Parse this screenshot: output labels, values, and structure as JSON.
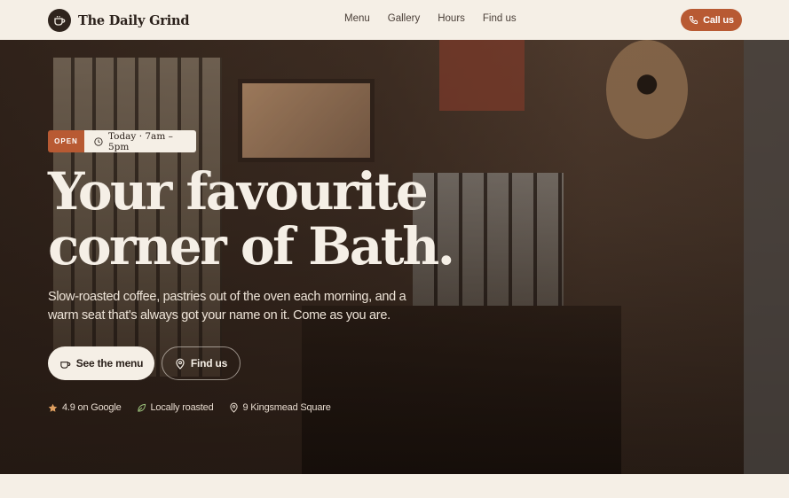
{
  "header": {
    "brand_name": "The Daily Grind",
    "nav": [
      "Menu",
      "Gallery",
      "Hours",
      "Find us"
    ],
    "call_label": "Call us"
  },
  "hero": {
    "status_badge": "OPEN",
    "hours": "Today · 7am – 5pm",
    "headline_line1": "Your favourite",
    "headline_line2": "corner of Bath.",
    "subtitle": "Slow-roasted coffee, pastries out of the oven each morning, and a warm seat that's always got your name on it. Come as you are.",
    "primary_cta": "See the menu",
    "secondary_cta": "Find us",
    "stats": [
      {
        "icon": "star-icon",
        "label": "4.9 on Google"
      },
      {
        "icon": "leaf-icon",
        "label": "Locally roasted"
      },
      {
        "icon": "map-pin-icon",
        "label": "9 Kingsmead Square"
      }
    ]
  },
  "colors": {
    "accent": "#b85a33",
    "cream": "#f5efe6",
    "dark": "#2b211b"
  }
}
